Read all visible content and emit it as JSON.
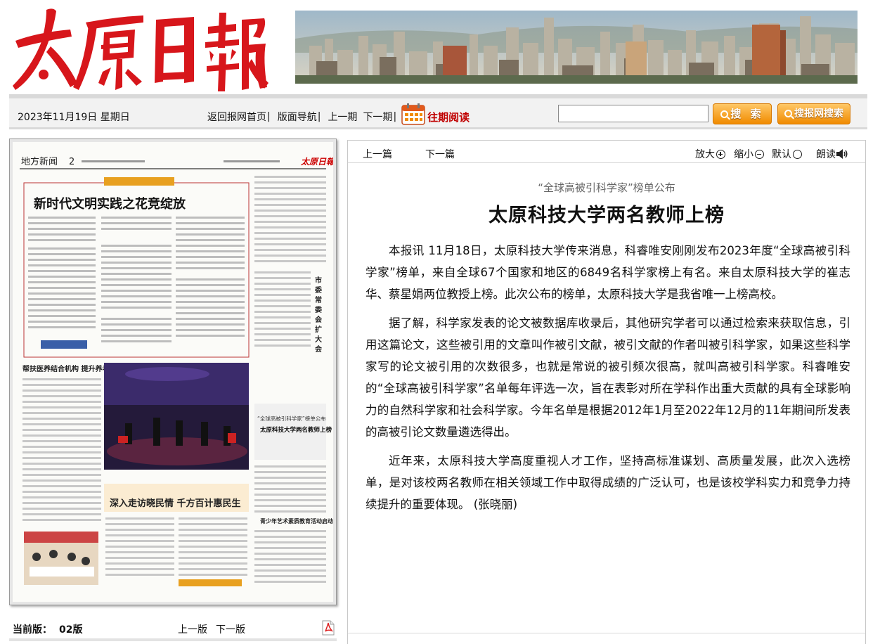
{
  "masthead": {
    "logo_text": "太原日報",
    "banner_alt": "city-skyline-photo"
  },
  "toolbar": {
    "date": "2023年11月19日 星期日",
    "nav": {
      "home": "返回报网首页",
      "layout_nav": "版面导航",
      "prev_issue": "上一期",
      "next_issue": "下一期",
      "sep": "|",
      "archive": "往期阅读"
    },
    "search": {
      "placeholder": "",
      "value": ""
    },
    "search_button": "搜 索",
    "site_search_button": "搜报网搜索"
  },
  "newspaper_page": {
    "section": "地方新闻",
    "page_no": "2",
    "headline_main": "新时代文明实践之花竞绽放",
    "headline_right_box": "太原科技大学两名教师上榜",
    "headline_left_small": "帮扶医养结合机构 提升养老服务能力",
    "headline_bottom": "深入走访晓民情 千方百计惠民生",
    "headline_bottom_right": "青少年艺术素质教育活动启动"
  },
  "pager": {
    "current_label": "当前版：",
    "current_value": "02版",
    "prev_page": "上一版",
    "next_page": "下一版"
  },
  "article_toolbar": {
    "prev_article": "上一篇",
    "next_article": "下一篇",
    "zoom_in": "放大",
    "zoom_out": "缩小",
    "default": "默认",
    "read_aloud": "朗读"
  },
  "article": {
    "subtitle": "“全球高被引科学家”榜单公布",
    "title": "太原科技大学两名教师上榜",
    "paragraphs": [
      "本报讯 11月18日，太原科技大学传来消息，科睿唯安刚刚发布2023年度“全球高被引科学家”榜单，来自全球67个国家和地区的6849名科学家榜上有名。来自太原科技大学的崔志华、蔡星娟两位教授上榜。此次公布的榜单，太原科技大学是我省唯一上榜高校。",
      "据了解，科学家发表的论文被数据库收录后，其他研究学者可以通过检索来获取信息，引用这篇论文，这些被引用的文章叫作被引文献，被引文献的作者叫被引科学家，如果这些科学家写的论文被引用的次数很多，也就是常说的被引频次很高，就叫高被引科学家。科睿唯安的“全球高被引科学家”名单每年评选一次，旨在表彰对所在学科作出重大贡献的具有全球影响力的自然科学家和社会科学家。今年名单是根据2012年1月至2022年12月的11年期间所发表的高被引论文数量遴选得出。",
      "近年来，太原科技大学高度重视人才工作，坚持高标准谋划、高质量发展，此次入选榜单，是对该校两名教师在相关领域工作中取得成绩的广泛认可，也是该校学科实力和竞争力持续提升的重要体现。 (张晓丽)"
    ]
  },
  "colors": {
    "logo_red": "#d7161b",
    "archive_red": "#c00000",
    "button_orange": "#f08b00"
  }
}
